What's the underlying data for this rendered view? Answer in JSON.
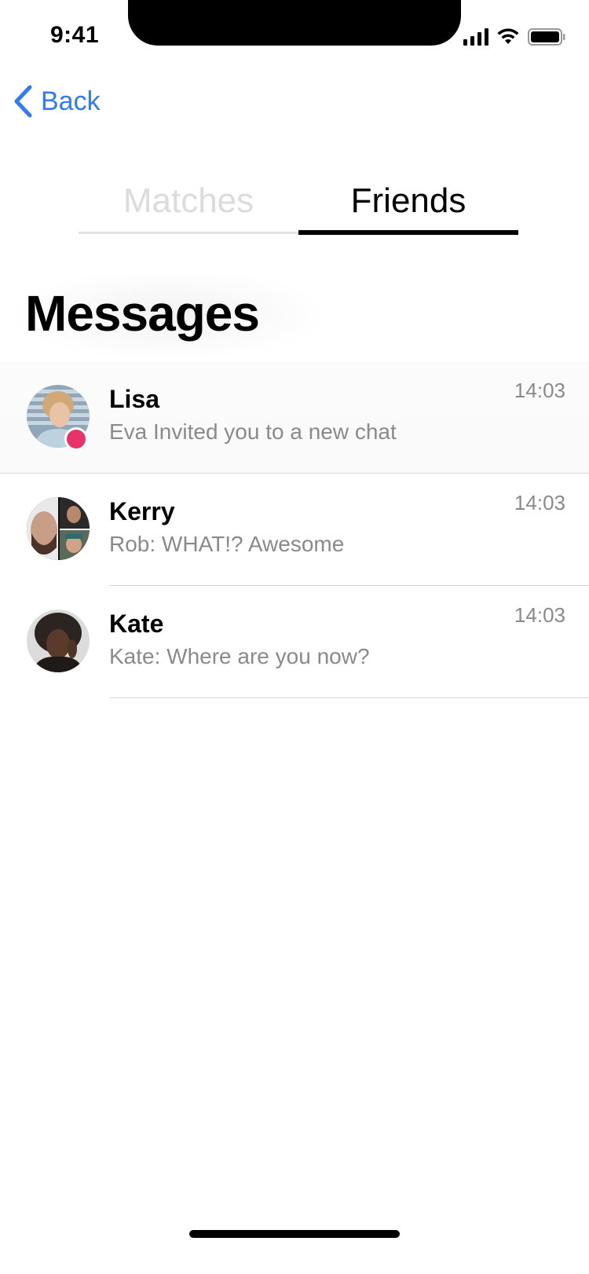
{
  "status_bar": {
    "time": "9:41",
    "icons": [
      "cellular-signal-icon",
      "wifi-icon",
      "battery-icon"
    ]
  },
  "nav": {
    "back_label": "Back",
    "back_icon": "chevron-left-icon",
    "accent_color": "#2f7cf6"
  },
  "tabs": [
    {
      "label": "Matches",
      "selected": false
    },
    {
      "label": "Friends",
      "selected": true
    }
  ],
  "page": {
    "title": "Messages"
  },
  "messages": [
    {
      "name": "Lisa",
      "preview": "Eva Invited you to a new chat",
      "time": "14:03",
      "online": true,
      "unread_dot_color": "#e8336a"
    },
    {
      "name": "Kerry",
      "preview": "Rob: WHAT!? Awesome",
      "time": "14:03",
      "online": false
    },
    {
      "name": "Kate",
      "preview": "Kate: Where are you now?",
      "time": "14:03",
      "online": false
    }
  ]
}
